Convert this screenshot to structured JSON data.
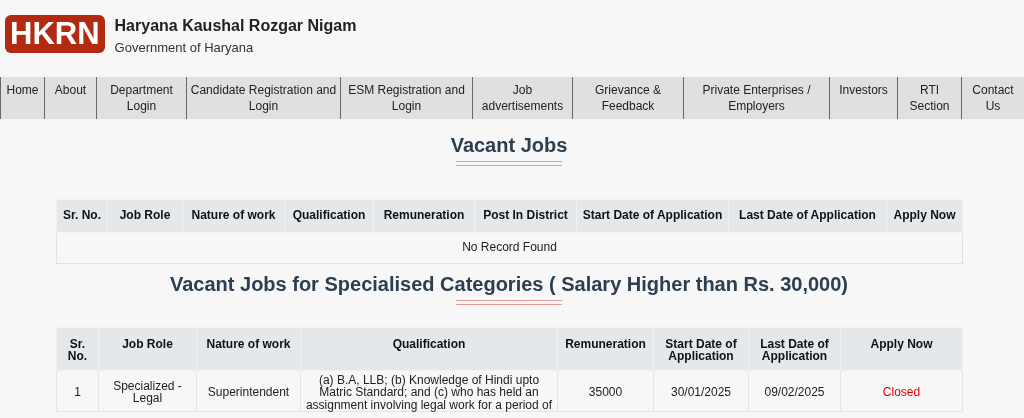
{
  "header": {
    "logo": "HKRN",
    "title": "Haryana Kaushal Rozgar Nigam",
    "subtitle": "Government of Haryana"
  },
  "nav": [
    {
      "label": "Home"
    },
    {
      "label": "About"
    },
    {
      "label": "Department Login"
    },
    {
      "label": "Candidate Registration and Login"
    },
    {
      "label": "ESM Registration and Login"
    },
    {
      "label": "Job advertisements"
    },
    {
      "label": "Grievance & Feedback"
    },
    {
      "label": "Private Enterprises / Employers"
    },
    {
      "label": "Investors"
    },
    {
      "label": "RTI Section"
    },
    {
      "label": "Contact Us"
    }
  ],
  "sections": [
    {
      "title": "Vacant Jobs",
      "columns": [
        "Sr. No.",
        "Job Role",
        "Nature of work",
        "Qualification",
        "Remuneration",
        "Post In District",
        "Start Date of Application",
        "Last Date of Application",
        "Apply Now"
      ],
      "empty_message": "No Record Found"
    },
    {
      "title": "Vacant Jobs for Specialised Categories ( Salary Higher than  Rs. 30,000)",
      "columns": [
        "Sr. No.",
        "Job Role",
        "Nature of work",
        "Qualification",
        "Remuneration",
        "Start Date of Application",
        "Last Date of Application",
        "Apply Now"
      ],
      "rows": [
        {
          "cells": [
            "1",
            "Specialized - Legal",
            "Superintendent",
            "(a) B.A, LLB; (b) Knowledge of Hindi upto Matric Standard; and (c) who has held an assignment involving legal work for a period of",
            "35000",
            "30/01/2025",
            "09/02/2025"
          ],
          "apply": {
            "text": "Closed",
            "kind": "closed"
          }
        }
      ]
    }
  ]
}
